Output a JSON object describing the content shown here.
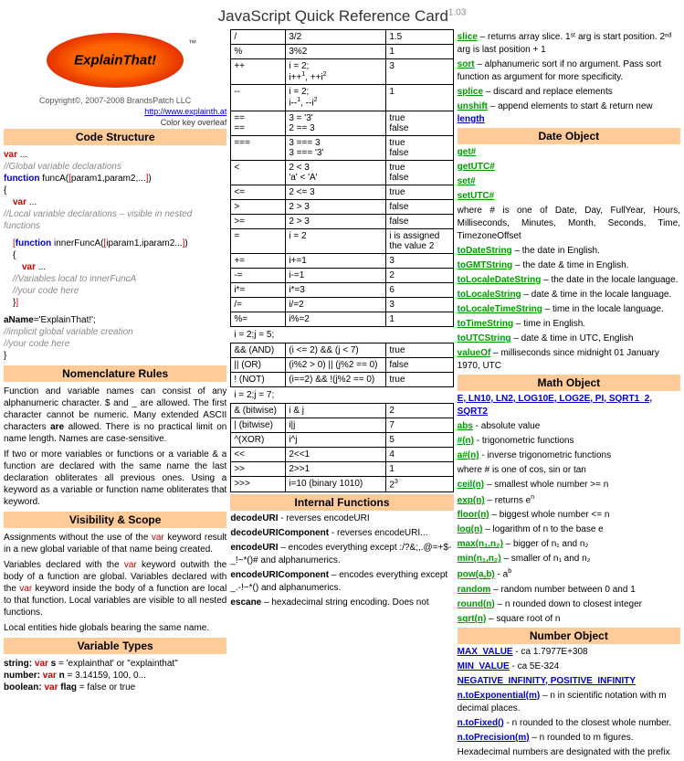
{
  "title": "JavaScript Quick Reference Card",
  "version": "1.03",
  "logo_text": "ExplainThat!",
  "tm": "™",
  "copyright": "Copyright©, 2007-2008 BrandsPatch LLC",
  "link_url": "http://www.explainth.at",
  "color_note": "Color key overleaf",
  "headings": {
    "code_structure": "Code Structure",
    "nomenclature": "Nomenclature Rules",
    "visibility": "Visibility & Scope",
    "vartypes": "Variable Types",
    "internal": "Internal Functions",
    "dateobj": "Date Object",
    "mathobj": "Math Object",
    "numobj": "Number Object"
  },
  "code_structure": {
    "l1a": "var",
    "l1b": " ...",
    "l2": "//Global variable declarations",
    "l3a": "function",
    "l3b": " funcA(",
    "l3c": "[",
    "l3d": "param1,param2,...",
    "l3e": "]",
    "l3f": ")",
    "l4": "{",
    "l5a": "var",
    "l5b": " ...",
    "l6": "//Local variable declarations – visible in nested functions",
    "l7a": "[",
    "l7b": "function",
    "l7c": " innerFuncA(",
    "l7d": "[",
    "l7e": "iparam1,iparam2...",
    "l7f": "]",
    "l7g": ")",
    "l8": "{",
    "l9a": "var",
    "l9b": " ...",
    "l10": "//Variables local to innerFuncA",
    "l11": "//your code here",
    "l12a": "}",
    "l12b": "]",
    "l14a": "aName",
    "l14b": "='ExplainThat!';",
    "l15": "//implicit global variable creation",
    "l16": "//your code here",
    "l17": "}"
  },
  "nomenclature_p1": "Function and variable names can consist of any alphanumeric character. $ and _ are allowed. The first character cannot be numeric. Many extended ASCII characters are allowed. There is no practical limit on name length. Names are case-sensitive.",
  "nomenclature_p1_bold": "are",
  "nomenclature_p2": "If two or more variables or functions or a variable & a function are declared with the same name the last declaration obliterates all previous ones. Using a keyword as a variable or function name obliterates that keyword.",
  "visibility_p1a": "Assignments without the use of the ",
  "visibility_p1b": " keyword result in a new global variable of that name being created.",
  "visibility_p2a": "Variables declared with the ",
  "visibility_p2b": " keyword outwith the body of a function are global. Variables declared with the ",
  "visibility_p2c": " keyword inside the body of a function are local to that function. Local variables are visible to all nested functions.",
  "visibility_p3": "Local entities hide globals bearing the same name.",
  "vartypes": {
    "l1a": "string: ",
    "l1b": "var",
    "l1c": " s",
    "l1d": " = 'explainthat' or \"explainthat\"",
    "l2a": "number: ",
    "l2b": "var",
    "l2c": " n",
    "l2d": " = 3.14159, 100, 0...",
    "l3a": "boolean: ",
    "l3b": "var",
    "l3c": " flag",
    "l3d": " = false or true"
  },
  "ops": [
    [
      "/",
      "3/2",
      "1.5"
    ],
    [
      "%",
      "3%2",
      "1"
    ],
    [
      "++",
      "i = 2;\ni++¹, ++i²",
      "3"
    ],
    [
      "--",
      "i = 2;\ni--¹, --i²",
      "1"
    ],
    [
      "==\n==",
      "3 = '3'\n2 == 3",
      "true\nfalse"
    ],
    [
      "===",
      "3 === 3\n3 === '3'",
      "true\nfalse"
    ],
    [
      "<",
      "2 < 3\n'a' < 'A'",
      "true\nfalse"
    ],
    [
      "<=",
      "2 <= 3",
      "true"
    ],
    [
      ">",
      "2 > 3",
      "false"
    ],
    [
      ">=",
      "2 > 3",
      "false"
    ],
    [
      "=",
      "i = 2",
      "i is assigned the value 2"
    ],
    [
      "+=",
      "i+=1",
      "3"
    ],
    [
      "-=",
      "i-=1",
      "2"
    ],
    [
      "i*=",
      "i*=3",
      "6"
    ],
    [
      "/=",
      "i/=2",
      "3"
    ],
    [
      "%=",
      "i%=2",
      "1"
    ]
  ],
  "stmt1": "i = 2;j = 5;",
  "ops2": [
    [
      "&& (AND)",
      "(i <= 2) && (j < 7)",
      "true"
    ],
    [
      "|| (OR)",
      "(i%2 > 0) || (j%2 == 0)",
      "false"
    ],
    [
      "! (NOT)",
      "(i==2) && !(j%2 == 0)",
      "true"
    ]
  ],
  "stmt2": "i = 2;j = 7;",
  "ops3": [
    [
      "& (bitwise)",
      "i & j",
      "2"
    ],
    [
      "| (bitwise)",
      "i|j",
      "7"
    ],
    [
      "^(XOR)",
      "i^j",
      "5"
    ],
    [
      "<<",
      "2<<1",
      "4"
    ],
    [
      ">>",
      "2>>1",
      "1"
    ],
    [
      ">>>",
      "i=10 (binary 1010)",
      "2³"
    ]
  ],
  "internal_funcs": [
    {
      "t": "decodeURI",
      "d": " - reverses encodeURI"
    },
    {
      "t": "decodeURIComponent",
      "d": " - reverses encodeURI..."
    },
    {
      "t": "encodeURI",
      "d": " – encodes everything except :/?&;,.@=+$-_!~*()# and alphanumerics."
    },
    {
      "t": "encodeURIComponent",
      "d": " – encodes everything except _.-!~*() and alphanumerics."
    },
    {
      "t": "escane",
      "d": " – hexadecimal string encoding. Does not"
    }
  ],
  "array_methods": [
    {
      "t": "slice",
      "d": " – returns array slice. 1ˢᵗ arg is start position. 2ⁿᵈ arg is last position + 1"
    },
    {
      "t": "sort",
      "d": " – alphanumeric sort if no argument. Pass sort function as argument for more specificity."
    },
    {
      "t": "splice",
      "d": " – discard and replace elements"
    },
    {
      "t": "unshift",
      "d1": " – append elements to start & return new ",
      "d2": "length"
    }
  ],
  "date_methods": {
    "get": "get#",
    "getUTC": "getUTC#",
    "set": "set#",
    "setUTC": "setUTC#",
    "note": "where # is one of Date, Day, FullYear, Hours, Milliseconds, Minutes, Month, Seconds, Time, TimezoneOffset",
    "items": [
      {
        "t": "toDateString",
        "d": " – the date in English."
      },
      {
        "t": "toGMTString",
        "d": " – the date & time in English."
      },
      {
        "t": "toLocaleDateString",
        "d": " – the date in the locale language."
      },
      {
        "t": "toLocaleString",
        "d": " – date & time in the locale language."
      },
      {
        "t": "toLocaleTimeString",
        "d": " – time in the locale language."
      },
      {
        "t": "toTimeString",
        "d": " – time in English."
      },
      {
        "t": "toUTCString",
        "d": " – date & time in UTC, English"
      },
      {
        "t": "valueOf",
        "d": " – milliseconds since midnight 01 January 1970, UTC"
      }
    ]
  },
  "math_consts": "E, LN10, LN2, LOG10E, LOG2E, PI, SQRT1_2, SQRT2",
  "math_items": [
    {
      "t": "abs",
      "d": " - absolute value"
    },
    {
      "t": "#(n)",
      "d": " - trigonometric functions"
    },
    {
      "t": "a#(n)",
      "d": " - inverse trigonometric functions"
    },
    {
      "n": "where # is one of cos, sin or tan"
    },
    {
      "t": "ceil(n)",
      "d": " – smallest whole number >= n"
    },
    {
      "t": "exp(n)",
      "d1": " – returns e",
      "d2": "n"
    },
    {
      "t": "floor(n)",
      "d": " – biggest whole number <= n"
    },
    {
      "t": "log(n)",
      "d": " – logarithm of n to the base e"
    },
    {
      "t": "max(n₁,n₂)",
      "d": " – bigger of n₁ and n₂"
    },
    {
      "t": "min(n₁,n₂)",
      "d": " – smaller of n₁ and n₂"
    },
    {
      "t": "pow(a,b)",
      "d1": " - a",
      "d2": "b"
    },
    {
      "t": "random",
      "d": " – random number between 0 and 1"
    },
    {
      "t": "round(n)",
      "d": " – n rounded down to closest integer"
    },
    {
      "t": "sqrt(n)",
      "d": " – square root of n"
    }
  ],
  "num_items": [
    {
      "t": "MAX_VALUE",
      "d": " - ca 1.7977E+308"
    },
    {
      "t": "MIN_VALUE",
      "d": " - ca 5E-324"
    },
    {
      "t2": "NEGATIVE_INFINITY, POSITIVE_INFINITY"
    },
    {
      "t": "n.toExponential(m)",
      "d": " – n in scientific notation with m decimal places."
    },
    {
      "t": "n.toFixed()",
      "d": " - n rounded to the closest whole number."
    },
    {
      "t": "n.toPrecision(m)",
      "d": " – n rounded to m figures."
    },
    {
      "n": "Hexadecimal numbers are designated with the prefix"
    }
  ]
}
